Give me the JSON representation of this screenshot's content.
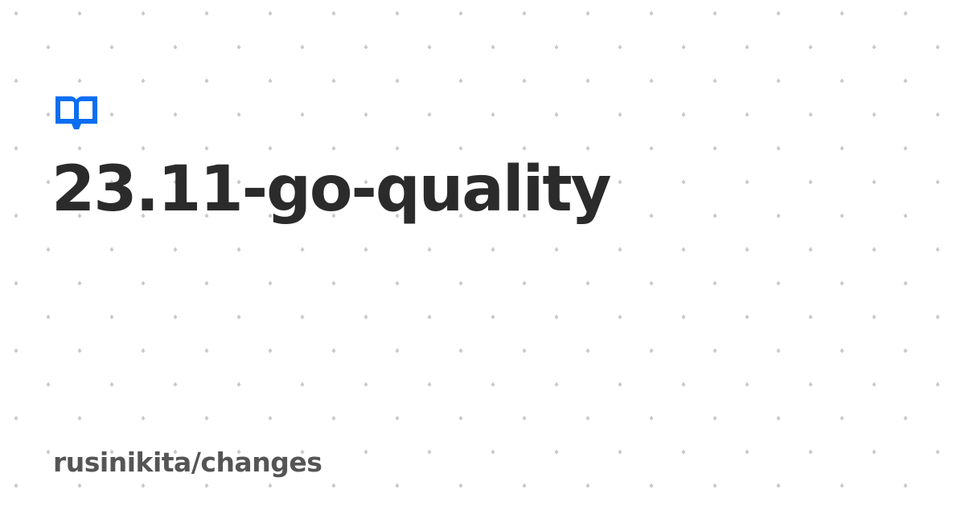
{
  "header": {
    "icon": "book-icon",
    "title": "23.11-go-quality"
  },
  "footer": {
    "repository": "rusinikita/changes"
  },
  "colors": {
    "accent": "#0b6ef2",
    "title": "#2b2b2b",
    "subtitle": "#555555",
    "pattern": "#c9c9c9",
    "background": "#ffffff"
  }
}
